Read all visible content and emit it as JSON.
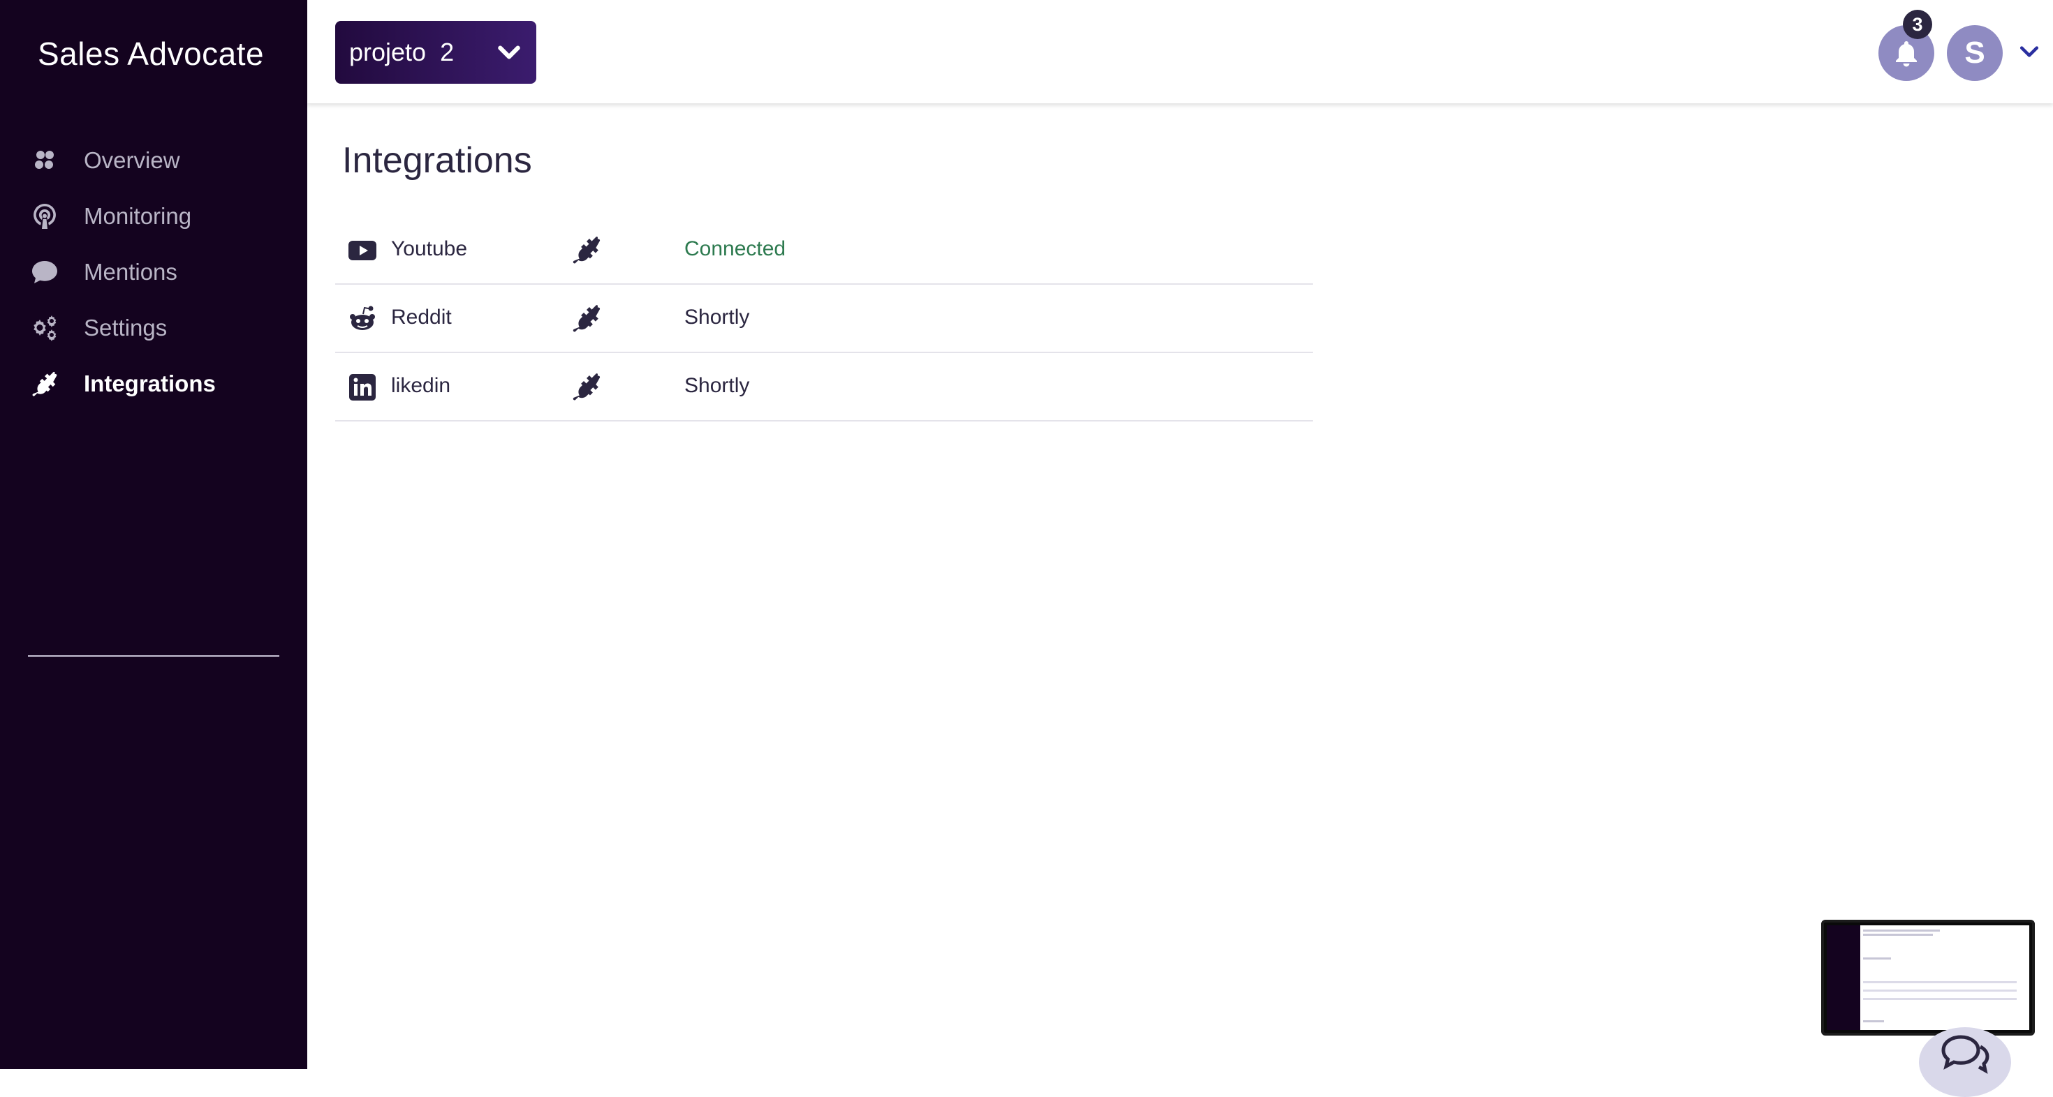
{
  "app": {
    "title": "Sales Advocate"
  },
  "sidebar": {
    "items": [
      {
        "label": "Overview",
        "icon": "overview-icon",
        "active": false
      },
      {
        "label": "Monitoring",
        "icon": "podcast-icon",
        "active": false
      },
      {
        "label": "Mentions",
        "icon": "comment-icon",
        "active": false
      },
      {
        "label": "Settings",
        "icon": "gears-icon",
        "active": false
      },
      {
        "label": "Integrations",
        "icon": "plug-icon",
        "active": true
      }
    ]
  },
  "header": {
    "project": {
      "selected": "projeto  2"
    },
    "notifications": {
      "count": "3",
      "icon": "bell-icon"
    },
    "user": {
      "initial": "S"
    }
  },
  "main": {
    "title": "Integrations",
    "integrations": [
      {
        "name": "Youtube",
        "icon": "youtube-icon",
        "status": "Connected",
        "connected": true
      },
      {
        "name": "Reddit",
        "icon": "reddit-icon",
        "status": "Shortly",
        "connected": false
      },
      {
        "name": "likedin",
        "icon": "linkedin-icon",
        "status": "Shortly",
        "connected": false
      }
    ]
  },
  "colors": {
    "sidebar_bg": "#14031f",
    "accent": "#2b2640",
    "connected": "#2d7a4f",
    "avatar_bg": "#8f8bc2"
  }
}
